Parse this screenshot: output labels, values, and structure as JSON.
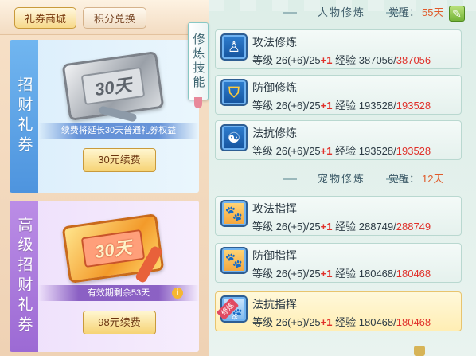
{
  "top_tabs": {
    "shop_label": "礼券商城",
    "points_label": "积分兑换"
  },
  "side_tab": {
    "label": "修炼技能"
  },
  "coupons": [
    {
      "title": "招财礼券",
      "ticket_text": "30天",
      "note": "续费将延长30天普通礼券权益",
      "button": "30元续费"
    },
    {
      "title": "高级招财礼券",
      "ticket_text": "30天",
      "note": "有效期剩余53天",
      "info_icon": "i",
      "button": "98元续费"
    }
  ],
  "character": {
    "title": "人物修炼",
    "awaken_label": "觉醒：",
    "awaken_value": "55天",
    "skills": [
      {
        "name": "攻法修炼",
        "level_label": "等级",
        "level": "26(+6)/25",
        "plus": "+1",
        "exp_label": "经验",
        "exp": "387056/",
        "exp_max": "387056",
        "icon": "meditate-icon"
      },
      {
        "name": "防御修炼",
        "level_label": "等级",
        "level": "26(+6)/25",
        "plus": "+1",
        "exp_label": "经验",
        "exp": "193528/",
        "exp_max": "193528",
        "icon": "shield-icon"
      },
      {
        "name": "法抗修炼",
        "level_label": "等级",
        "level": "26(+6)/25",
        "plus": "+1",
        "exp_label": "经验",
        "exp": "193528/",
        "exp_max": "193528",
        "icon": "taiji-icon"
      }
    ]
  },
  "pet": {
    "title": "宠物修炼",
    "awaken_label": "觉醒：",
    "awaken_value": "12天",
    "skills": [
      {
        "name": "攻法指挥",
        "level_label": "等级",
        "level": "26(+5)/25",
        "plus": "+1",
        "exp_label": "经验",
        "exp": "288749/",
        "exp_max": "288749",
        "icon": "paw-attack-icon"
      },
      {
        "name": "防御指挥",
        "level_label": "等级",
        "level": "26(+5)/25",
        "plus": "+1",
        "exp_label": "经验",
        "exp": "180468/",
        "exp_max": "180468",
        "icon": "paw-shield-icon"
      },
      {
        "name": "法抗指挥",
        "level_label": "等级",
        "level": "26(+5)/25",
        "plus": "+1",
        "exp_label": "经验",
        "exp": "180468/",
        "exp_max": "180468",
        "icon": "paw-magic-icon",
        "badge": "修炼中"
      }
    ]
  },
  "colors": {
    "accent_red": "#e0302a",
    "awaken_orange": "#e05a2a",
    "coupon_blue": "#4e94de",
    "coupon_purple": "#9c6ad4"
  }
}
